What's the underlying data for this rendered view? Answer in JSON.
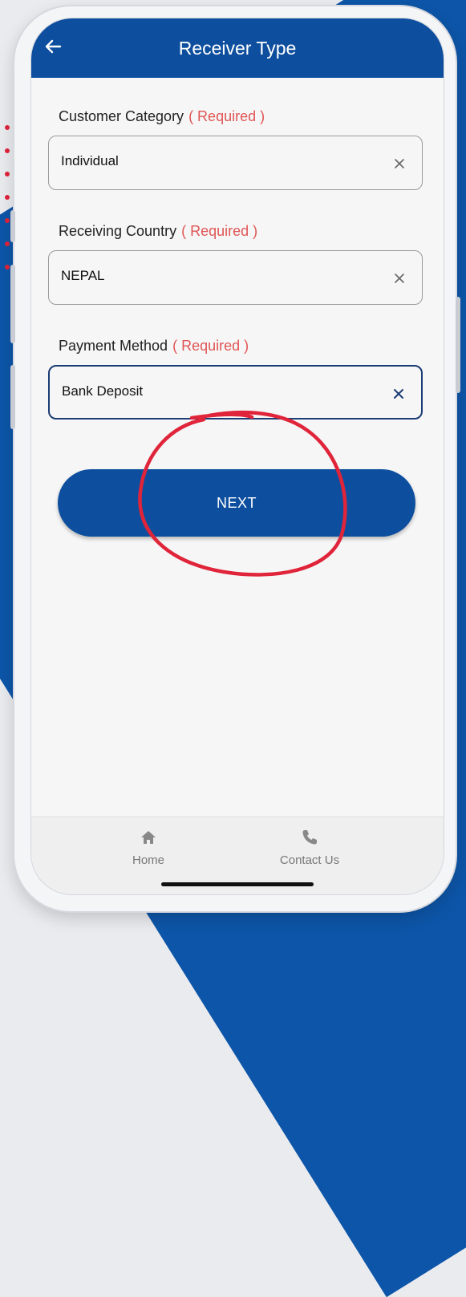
{
  "header": {
    "title": "Receiver Type"
  },
  "form": {
    "required_text": "( Required )",
    "fields": [
      {
        "label": "Customer Category",
        "value": "Individual",
        "active": false
      },
      {
        "label": "Receiving Country",
        "value": "NEPAL",
        "active": false
      },
      {
        "label": "Payment Method",
        "value": "Bank Deposit",
        "active": true
      }
    ],
    "next_label": "NEXT"
  },
  "bottom_nav": {
    "items": [
      {
        "label": "Home",
        "icon": "home-icon"
      },
      {
        "label": "Contact Us",
        "icon": "phone-icon"
      }
    ]
  },
  "colors": {
    "primary": "#0d4f9e",
    "required": "#e05555",
    "annotation": "#e0243a",
    "active_border": "#1b3c74"
  }
}
